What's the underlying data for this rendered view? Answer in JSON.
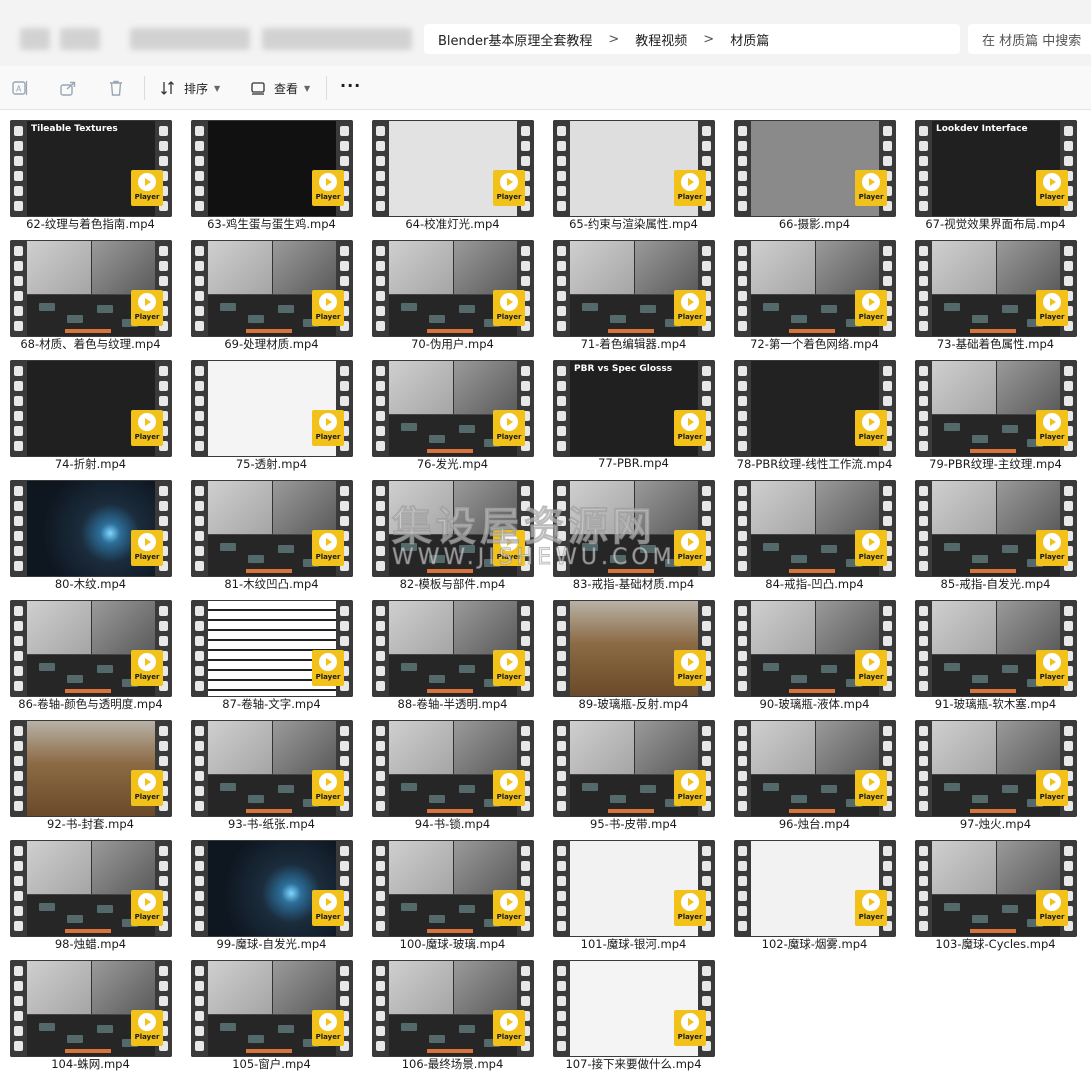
{
  "breadcrumb": {
    "items": [
      "Blender基本原理全套教程",
      "教程视频",
      "材质篇"
    ],
    "separator": ">"
  },
  "search": {
    "placeholder": "在 材质篇 中搜索"
  },
  "toolbar": {
    "sort_label": "排序",
    "view_label": "查看",
    "more_label": "···"
  },
  "badge_label": "Player",
  "watermark": {
    "line1": "集设屋资源网",
    "line2": "WWW.JISHEWU.COM"
  },
  "thumb_titles": {
    "62": "Tileable Textures",
    "67": "Lookdev Interface",
    "77": "PBR vs Spec Glosss"
  },
  "files": [
    "62-纹理与着色指南.mp4",
    "63-鸡生蛋与蛋生鸡.mp4",
    "64-校准灯光.mp4",
    "65-约束与渲染属性.mp4",
    "66-摄影.mp4",
    "67-视觉效果界面布局.mp4",
    "68-材质、着色与纹理.mp4",
    "69-处理材质.mp4",
    "70-伪用户.mp4",
    "71-着色编辑器.mp4",
    "72-第一个着色网络.mp4",
    "73-基础着色属性.mp4",
    "74-折射.mp4",
    "75-透射.mp4",
    "76-发光.mp4",
    "77-PBR.mp4",
    "78-PBR纹理-线性工作流.mp4",
    "79-PBR纹理-主纹理.mp4",
    "80-木纹.mp4",
    "81-木纹凹凸.mp4",
    "82-模板与部件.mp4",
    "83-戒指-基础材质.mp4",
    "84-戒指-凹凸.mp4",
    "85-戒指-自发光.mp4",
    "86-卷轴-颜色与透明度.mp4",
    "87-卷轴-文字.mp4",
    "88-卷轴-半透明.mp4",
    "89-玻璃瓶-反射.mp4",
    "90-玻璃瓶-液体.mp4",
    "91-玻璃瓶-软木塞.mp4",
    "92-书-封套.mp4",
    "93-书-纸张.mp4",
    "94-书-锁.mp4",
    "95-书-皮带.mp4",
    "96-烛台.mp4",
    "97-烛火.mp4",
    "98-烛蜡.mp4",
    "99-魔球-自发光.mp4",
    "100-魔球-玻璃.mp4",
    "101-魔球-银河.mp4",
    "102-魔球-烟雾.mp4",
    "103-魔球-Cycles.mp4",
    "104-蛛网.mp4",
    "105-窗户.mp4",
    "106-最终场景.mp4",
    "107-接下来要做什么.mp4"
  ],
  "colors": {
    "badge": "#f3c21a",
    "film": "#3a3a3a",
    "accent": "#d9743a"
  }
}
